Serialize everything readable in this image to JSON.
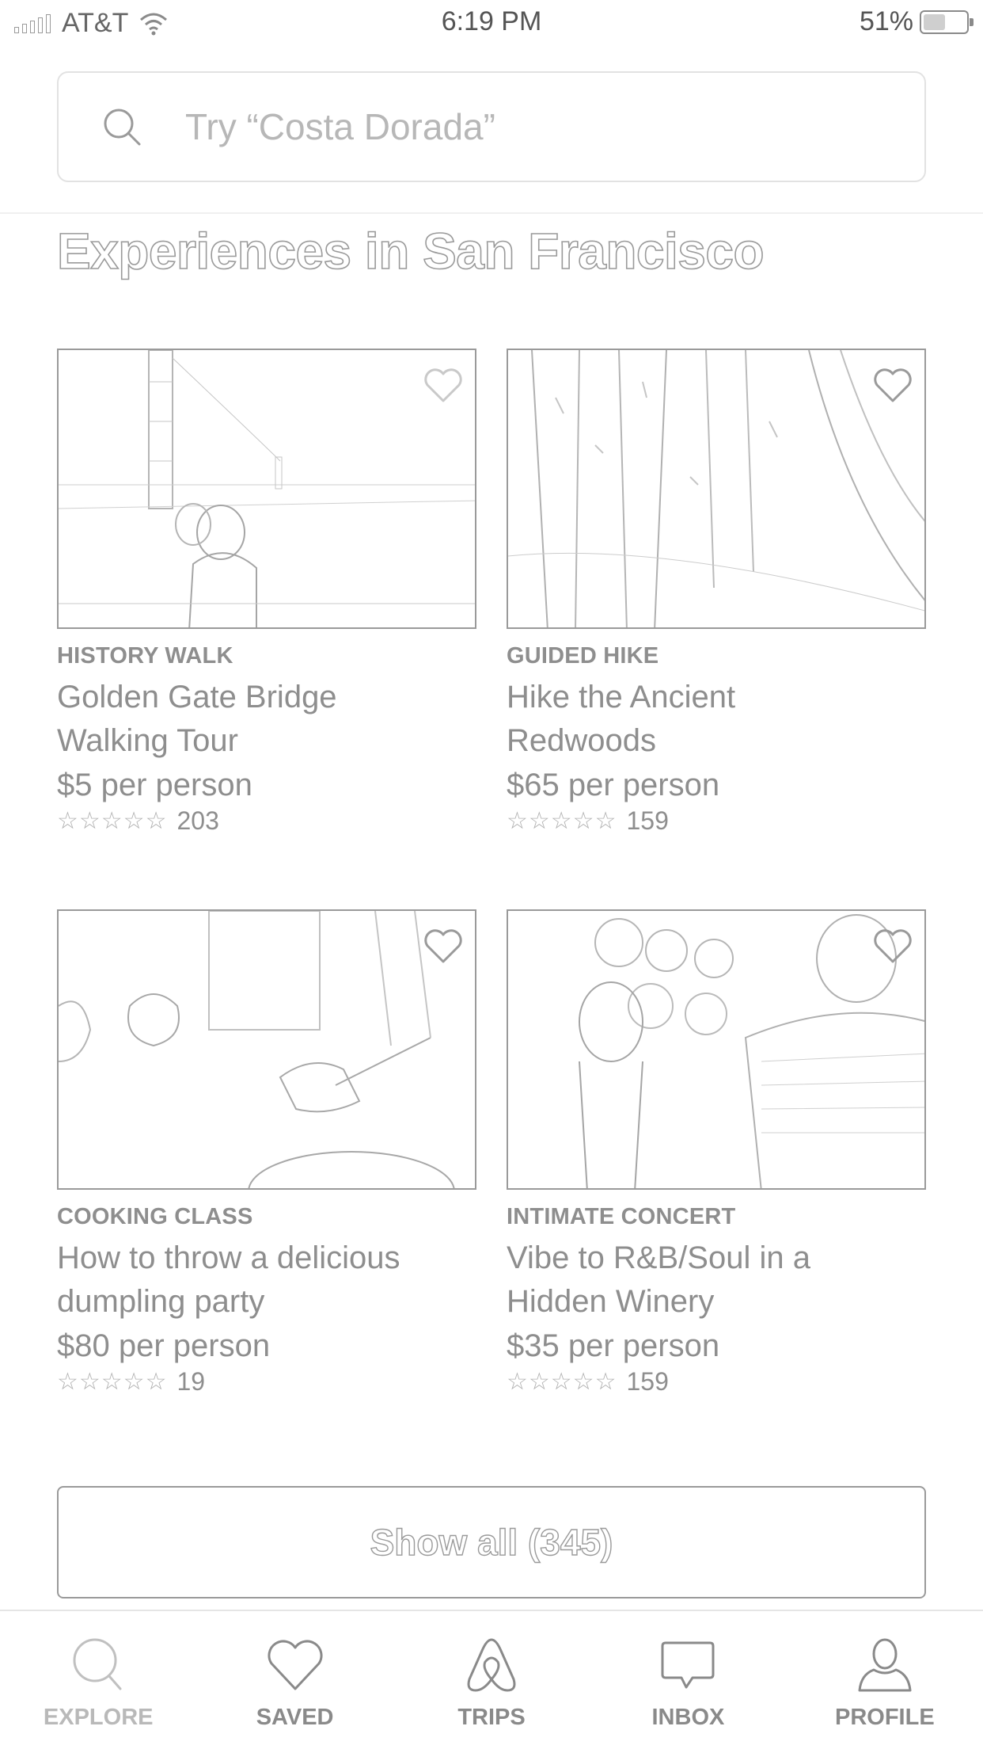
{
  "status_bar": {
    "carrier": "AT&T",
    "time": "6:19 PM",
    "battery": "51%",
    "battery_level": 0.51
  },
  "search": {
    "placeholder": "Try “Costa Dorada”"
  },
  "section": {
    "title": "Experiences in San Francisco"
  },
  "experiences": [
    {
      "category": "HISTORY WALK",
      "title_line1": "Golden Gate Bridge",
      "title_line2": "Walking Tour",
      "price": "$5 per person",
      "stars": "☆☆☆☆☆",
      "reviews": "203"
    },
    {
      "category": "GUIDED HIKE",
      "title_line1": "Hike the Ancient",
      "title_line2": "Redwoods",
      "price": "$65 per person",
      "stars": "☆☆☆☆☆",
      "reviews": "159"
    },
    {
      "category": "COOKING CLASS",
      "title_line1": "How to throw a delicious",
      "title_line2": "dumpling party",
      "price": "$80 per person",
      "stars": "☆☆☆☆☆",
      "reviews": "19"
    },
    {
      "category": "INTIMATE CONCERT",
      "title_line1": "Vibe to R&B/Soul in a",
      "title_line2": "Hidden Winery",
      "price": "$35 per person",
      "stars": "☆☆☆☆☆",
      "reviews": "159"
    }
  ],
  "show_all": {
    "label": "Show all (345)"
  },
  "tabs": [
    {
      "label": "EXPLORE",
      "icon": "search-icon"
    },
    {
      "label": "SAVED",
      "icon": "heart-icon"
    },
    {
      "label": "TRIPS",
      "icon": "airbnb-logo-icon"
    },
    {
      "label": "INBOX",
      "icon": "chat-bubble-icon"
    },
    {
      "label": "PROFILE",
      "icon": "person-icon"
    }
  ]
}
